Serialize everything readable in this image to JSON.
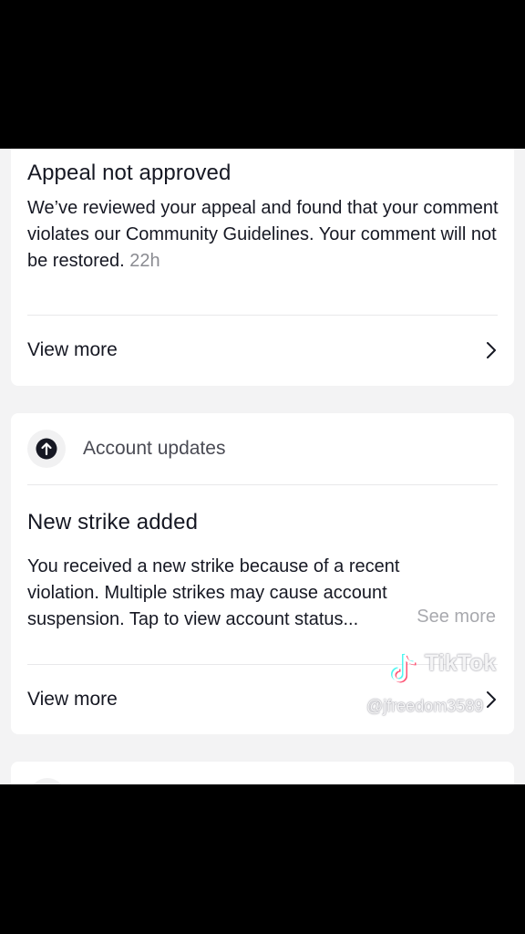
{
  "card_appeal": {
    "title": "Appeal not approved",
    "body": "We’ve reviewed your appeal and found that your comment violates our Community Guidelines. Your comment will not be restored.",
    "time": "22h",
    "view_more": "View more"
  },
  "card_account": {
    "section_label": "Account updates",
    "section_icon": "arrow-up-circle-icon",
    "title": "New strike added",
    "body": "You received a new strike because of a recent violation. Multiple strikes may cause account suspension. Tap to view account status...",
    "see_more": "See more",
    "view_more": "View more"
  },
  "watermark": {
    "brand": "TikTok",
    "username": "@jfreedom3589"
  },
  "colors": {
    "text_primary": "#161823",
    "text_secondary": "#8a8b91",
    "background": "#f3f3f4",
    "card": "#ffffff"
  }
}
